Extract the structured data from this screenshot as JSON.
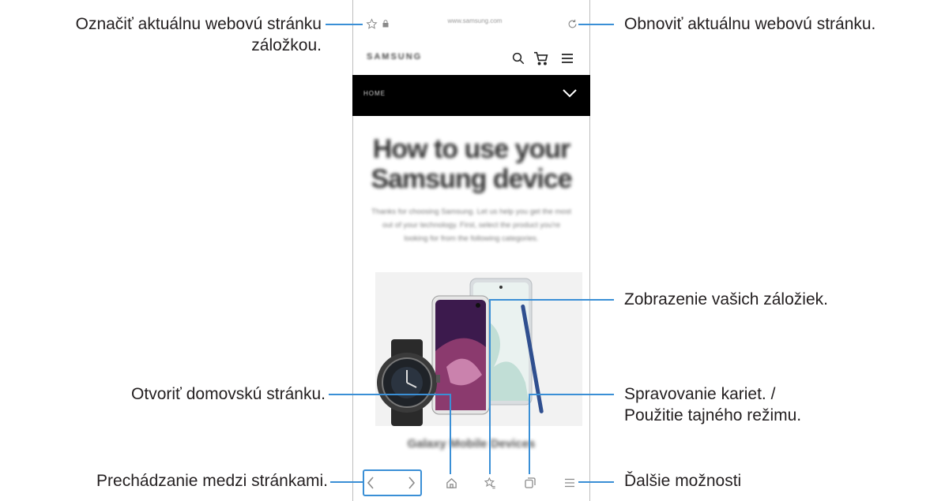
{
  "browser": {
    "url": "www.samsung.com",
    "site_brand": "SAMSUNG",
    "menu_label": "HOME",
    "hero_title": "How to use your Samsung device",
    "hero_sub": "Thanks for choosing Samsung. Let us help you get the most out of your technology. First, select the product you're looking for from the following categories.",
    "product_caption": "Galaxy Mobile Devices",
    "icons": {
      "bookmark_add": "star-outline-icon",
      "lock": "lock-icon",
      "reload": "reload-icon",
      "search": "search-icon",
      "cart": "cart-icon",
      "menu": "hamburger-icon",
      "chevron": "chevron-down-icon",
      "back": "back-arrow-icon",
      "forward": "forward-arrow-icon",
      "home": "home-icon",
      "bookmarks": "bookmarks-icon",
      "tabs": "tabs-icon",
      "more": "more-options-icon"
    }
  },
  "callouts": {
    "bookmark_line1": "Označiť aktuálnu webovú stránku",
    "bookmark_line2": "záložkou.",
    "reload": "Obnoviť aktuálnu webovú stránku.",
    "bookmarks": "Zobrazenie vašich záložiek.",
    "home": "Otvoriť domovskú stránku.",
    "tabs_line1": "Spravovanie kariet. /",
    "tabs_line2": "Použitie tajného režimu.",
    "navigate": "Prechádzanie medzi stránkami.",
    "more": "Ďalšie možnosti"
  },
  "colors": {
    "accent": "#3a8fd6",
    "menubar": "#000000"
  }
}
